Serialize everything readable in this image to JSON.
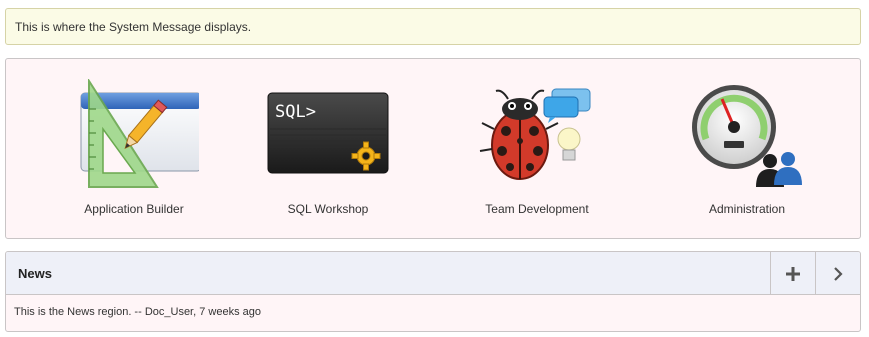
{
  "system_message": "This is where the System Message displays.",
  "apps": [
    {
      "label": "Application Builder",
      "icon": "application-builder-icon"
    },
    {
      "label": "SQL Workshop",
      "icon": "sql-workshop-icon",
      "icon_text": "SQL>"
    },
    {
      "label": "Team Development",
      "icon": "team-development-icon"
    },
    {
      "label": "Administration",
      "icon": "administration-icon"
    }
  ],
  "news": {
    "title": "News",
    "add_icon": "plus-icon",
    "next_icon": "chevron-right-icon",
    "body": "This is the News region. -- Doc_User, 7 weeks ago"
  },
  "colors": {
    "system_message_bg": "#fbfbe6",
    "region_bg": "#fff5f7",
    "news_header_bg": "#eef0f8"
  }
}
